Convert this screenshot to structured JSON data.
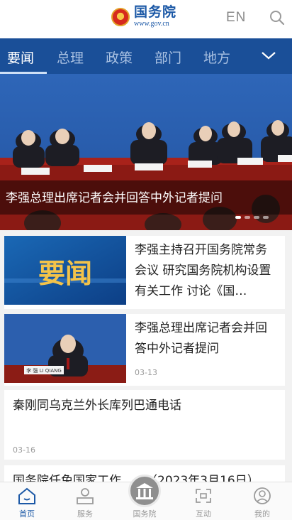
{
  "header": {
    "site_name": "国务院",
    "site_url": "www.gov.cn",
    "lang_label": "EN"
  },
  "tabs": [
    {
      "label": "要闻",
      "active": true
    },
    {
      "label": "总理",
      "active": false
    },
    {
      "label": "政策",
      "active": false
    },
    {
      "label": "部门",
      "active": false
    },
    {
      "label": "地方",
      "active": false
    }
  ],
  "hero": {
    "caption": "李强总理出席记者会并回答中外记者提问",
    "slides_total": 4,
    "slide_active": 1
  },
  "news": [
    {
      "title": "李强主持召开国务院常务会议 研究国务院机构设置有关工作 讨论《国…",
      "thumb_text": "要闻",
      "date": ""
    },
    {
      "title": "李强总理出席记者会并回答中外记者提问",
      "thumb_text": "李 强 LI QIANG",
      "date": "03-13"
    },
    {
      "title": "秦刚同乌克兰外长库列巴通电话",
      "date": "03-16"
    },
    {
      "title": "国务院任免国家工作……（2023年3月16日）",
      "date": ""
    }
  ],
  "bottom_nav": [
    {
      "label": "首页",
      "icon": "home-icon",
      "active": true
    },
    {
      "label": "服务",
      "icon": "service-icon",
      "active": false
    },
    {
      "label": "国务院",
      "icon": "state-council-icon",
      "active": false
    },
    {
      "label": "互动",
      "icon": "interact-icon",
      "active": false
    },
    {
      "label": "我的",
      "icon": "profile-icon",
      "active": false
    }
  ],
  "colors": {
    "brand_blue": "#1a4f98",
    "accent_red": "#d62a1e"
  }
}
